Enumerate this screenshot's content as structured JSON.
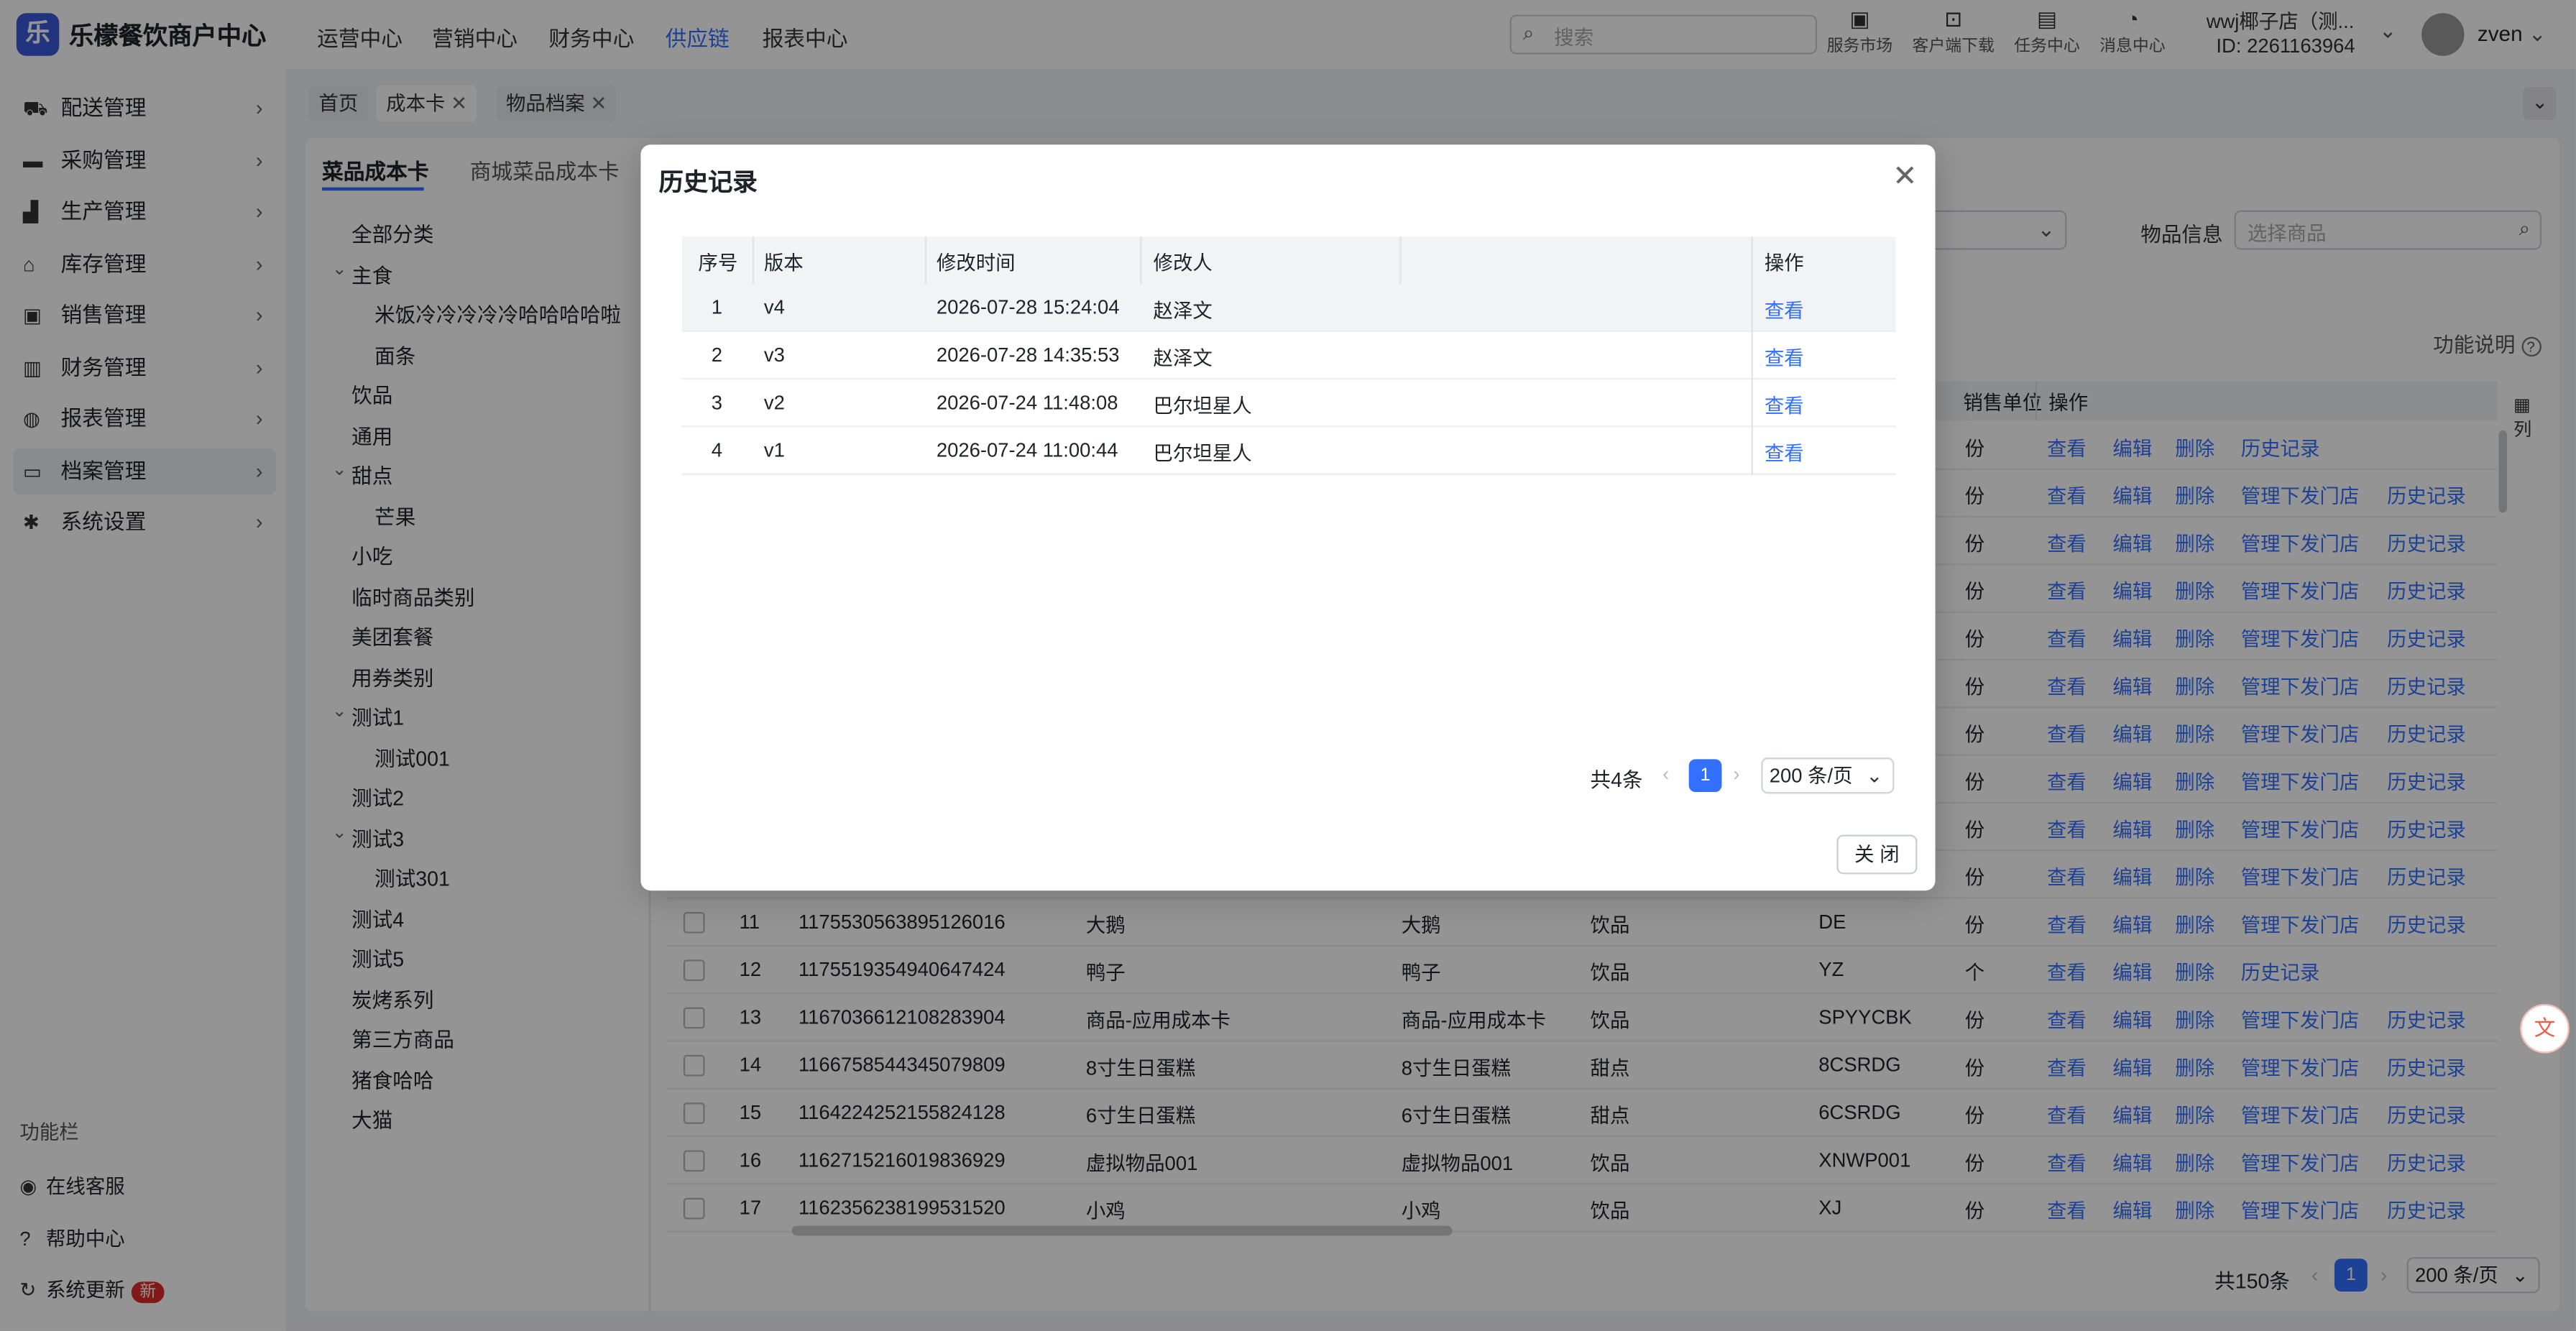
{
  "app": {
    "logo_char": "乐",
    "title": "乐檬餐饮商户中心"
  },
  "topnav": [
    "运营中心",
    "营销中心",
    "财务中心",
    "供应链",
    "报表中心"
  ],
  "topnav_active": 3,
  "search": {
    "placeholder": "搜索"
  },
  "tools": [
    {
      "label": "服务市场",
      "icon": "bag-icon"
    },
    {
      "label": "客户端下载",
      "icon": "download-folder-icon"
    },
    {
      "label": "任务中心",
      "icon": "clipboard-icon"
    },
    {
      "label": "消息中心",
      "icon": "bell-icon"
    }
  ],
  "store": {
    "name": "wwj椰子店（测...",
    "id": "ID: 2261163964"
  },
  "user": {
    "name": "zven"
  },
  "sidebar": {
    "items": [
      {
        "label": "配送管理",
        "icon": "truck-icon"
      },
      {
        "label": "采购管理",
        "icon": "cart-icon"
      },
      {
        "label": "生产管理",
        "icon": "factory-icon"
      },
      {
        "label": "库存管理",
        "icon": "warehouse-icon"
      },
      {
        "label": "销售管理",
        "icon": "briefcase-icon"
      },
      {
        "label": "财务管理",
        "icon": "receipt-icon"
      },
      {
        "label": "报表管理",
        "icon": "globe-icon"
      },
      {
        "label": "档案管理",
        "icon": "archive-icon"
      },
      {
        "label": "系统设置",
        "icon": "gear-icon"
      }
    ],
    "active": 7,
    "footer_header": "功能栏",
    "footer": [
      {
        "label": "在线客服",
        "icon": "headset-icon"
      },
      {
        "label": "帮助中心",
        "icon": "help-icon"
      },
      {
        "label": "系统更新",
        "icon": "refresh-icon",
        "badge": "新"
      }
    ]
  },
  "page_tabs": [
    {
      "label": "首页",
      "closable": false
    },
    {
      "label": "成本卡",
      "closable": true,
      "active": true
    },
    {
      "label": "物品档案",
      "closable": true
    }
  ],
  "sub_tabs": [
    "菜品成本卡",
    "商城菜品成本卡"
  ],
  "tree": [
    {
      "label": "全部分类",
      "level": 0
    },
    {
      "label": "主食",
      "level": 0,
      "toggle": "open"
    },
    {
      "label": "米饭冷冷冷冷冷哈哈哈哈啦",
      "level": 1
    },
    {
      "label": "面条",
      "level": 1
    },
    {
      "label": "饮品",
      "level": 0
    },
    {
      "label": "通用",
      "level": 0
    },
    {
      "label": "甜点",
      "level": 0,
      "toggle": "open"
    },
    {
      "label": "芒果",
      "level": 1
    },
    {
      "label": "小吃",
      "level": 0
    },
    {
      "label": "临时商品类别",
      "level": 0
    },
    {
      "label": "美团套餐",
      "level": 0
    },
    {
      "label": "用券类别",
      "level": 0
    },
    {
      "label": "测试1",
      "level": 0,
      "toggle": "open"
    },
    {
      "label": "测试001",
      "level": 1
    },
    {
      "label": "测试2",
      "level": 0
    },
    {
      "label": "测试3",
      "level": 0,
      "toggle": "open"
    },
    {
      "label": "测试301",
      "level": 1
    },
    {
      "label": "测试4",
      "level": 0
    },
    {
      "label": "测试5",
      "level": 0
    },
    {
      "label": "炭烤系列",
      "level": 0
    },
    {
      "label": "第三方商品",
      "level": 0
    },
    {
      "label": "猪食哈哈",
      "level": 0
    },
    {
      "label": "大猫",
      "level": 0
    }
  ],
  "filter": {
    "label": "物品信息",
    "placeholder": "选择商品"
  },
  "help_link": "功能说明",
  "main_table": {
    "header_visible": [
      "销售单位",
      "操作"
    ],
    "column_settings": "列",
    "partial_rows": [
      {
        "unit": "份",
        "actions": [
          "查看",
          "编辑",
          "删除",
          "历史记录"
        ]
      },
      {
        "unit": "份",
        "actions": [
          "查看",
          "编辑",
          "删除",
          "管理下发门店",
          "历史记录"
        ]
      },
      {
        "unit": "份",
        "actions": [
          "查看",
          "编辑",
          "删除",
          "管理下发门店",
          "历史记录"
        ]
      },
      {
        "unit": "份",
        "actions": [
          "查看",
          "编辑",
          "删除",
          "管理下发门店",
          "历史记录"
        ]
      },
      {
        "unit": "份",
        "actions": [
          "查看",
          "编辑",
          "删除",
          "管理下发门店",
          "历史记录"
        ]
      },
      {
        "unit": "份",
        "actions": [
          "查看",
          "编辑",
          "删除",
          "管理下发门店",
          "历史记录"
        ]
      },
      {
        "unit": "份",
        "actions": [
          "查看",
          "编辑",
          "删除",
          "管理下发门店",
          "历史记录"
        ]
      },
      {
        "unit": "份",
        "actions": [
          "查看",
          "编辑",
          "删除",
          "管理下发门店",
          "历史记录"
        ]
      },
      {
        "unit": "份",
        "actions": [
          "查看",
          "编辑",
          "删除",
          "管理下发门店",
          "历史记录"
        ]
      },
      {
        "unit": "份",
        "actions": [
          "查看",
          "编辑",
          "删除",
          "管理下发门店",
          "历史记录"
        ]
      }
    ],
    "rows": [
      {
        "no": "11",
        "code": "1175530563895126016",
        "name": "大鹅",
        "alias": "大鹅",
        "cat": "饮品",
        "abbr": "DE",
        "unit": "份",
        "actions": [
          "查看",
          "编辑",
          "删除",
          "管理下发门店",
          "历史记录"
        ]
      },
      {
        "no": "12",
        "code": "1175519354940647424",
        "name": "鸭子",
        "alias": "鸭子",
        "cat": "饮品",
        "abbr": "YZ",
        "unit": "个",
        "actions": [
          "查看",
          "编辑",
          "删除",
          "历史记录"
        ]
      },
      {
        "no": "13",
        "code": "1167036612108283904",
        "name": "商品-应用成本卡",
        "alias": "商品-应用成本卡",
        "cat": "饮品",
        "abbr": "SPYYCBK",
        "unit": "份",
        "actions": [
          "查看",
          "编辑",
          "删除",
          "管理下发门店",
          "历史记录"
        ]
      },
      {
        "no": "14",
        "code": "1166758544345079809",
        "name": "8寸生日蛋糕",
        "alias": "8寸生日蛋糕",
        "cat": "甜点",
        "abbr": "8CSRDG",
        "unit": "份",
        "actions": [
          "查看",
          "编辑",
          "删除",
          "管理下发门店",
          "历史记录"
        ]
      },
      {
        "no": "15",
        "code": "1164224252155824128",
        "name": "6寸生日蛋糕",
        "alias": "6寸生日蛋糕",
        "cat": "甜点",
        "abbr": "6CSRDG",
        "unit": "份",
        "actions": [
          "查看",
          "编辑",
          "删除",
          "管理下发门店",
          "历史记录"
        ]
      },
      {
        "no": "16",
        "code": "1162715216019836929",
        "name": "虚拟物品001",
        "alias": "虚拟物品001",
        "cat": "饮品",
        "abbr": "XNWP001",
        "unit": "份",
        "actions": [
          "查看",
          "编辑",
          "删除",
          "管理下发门店",
          "历史记录"
        ]
      },
      {
        "no": "17",
        "code": "1162356238199531520",
        "name": "小鸡",
        "alias": "小鸡",
        "cat": "饮品",
        "abbr": "XJ",
        "unit": "份",
        "actions": [
          "查看",
          "编辑",
          "删除",
          "管理下发门店",
          "历史记录"
        ]
      }
    ],
    "pagination": {
      "total": "共150条",
      "current": "1",
      "page_size": "200 条/页"
    }
  },
  "modal": {
    "title": "历史记录",
    "columns": [
      "序号",
      "版本",
      "修改时间",
      "修改人",
      "操作"
    ],
    "rows": [
      {
        "no": "1",
        "version": "v4",
        "time": "2026-07-28 15:24:04",
        "editor": "赵泽文",
        "action": "查看"
      },
      {
        "no": "2",
        "version": "v3",
        "time": "2026-07-28 14:35:53",
        "editor": "赵泽文",
        "action": "查看"
      },
      {
        "no": "3",
        "version": "v2",
        "time": "2026-07-24 11:48:08",
        "editor": "巴尔坦星人",
        "action": "查看"
      },
      {
        "no": "4",
        "version": "v1",
        "time": "2026-07-24 11:00:44",
        "editor": "巴尔坦星人",
        "action": "查看"
      }
    ],
    "pagination": {
      "total": "共4条",
      "current": "1",
      "page_size": "200 条/页"
    },
    "close_button": "关 闭"
  },
  "colors": {
    "accent": "#3370ff",
    "brand": "#3b5bdb",
    "badge": "#e02a2a"
  }
}
